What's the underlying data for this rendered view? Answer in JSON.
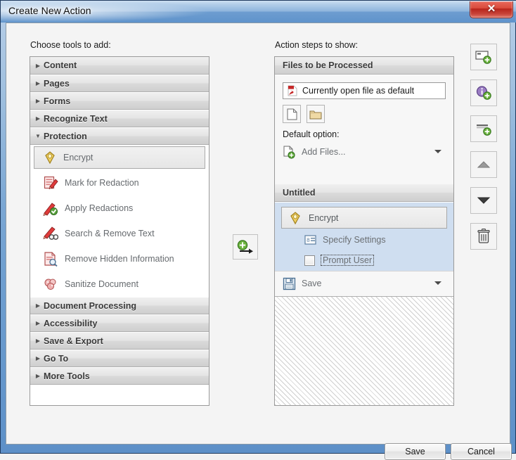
{
  "window": {
    "title": "Create New Action",
    "close_label": "✕"
  },
  "left": {
    "heading": "Choose tools to add:",
    "categories": [
      {
        "label": "Content",
        "expanded": false
      },
      {
        "label": "Pages",
        "expanded": false
      },
      {
        "label": "Forms",
        "expanded": false
      },
      {
        "label": "Recognize Text",
        "expanded": false
      },
      {
        "label": "Protection",
        "expanded": true
      },
      {
        "label": "Document Processing",
        "expanded": false
      },
      {
        "label": "Accessibility",
        "expanded": false
      },
      {
        "label": "Save & Export",
        "expanded": false
      },
      {
        "label": "Go To",
        "expanded": false
      },
      {
        "label": "More Tools",
        "expanded": false
      }
    ],
    "protection_tools": [
      {
        "label": "Encrypt",
        "icon": "shield-icon",
        "selected": true
      },
      {
        "label": "Mark for Redaction",
        "icon": "redaction-pen-icon",
        "selected": false
      },
      {
        "label": "Apply Redactions",
        "icon": "apply-redaction-icon",
        "selected": false
      },
      {
        "label": "Search & Remove Text",
        "icon": "search-remove-icon",
        "selected": false
      },
      {
        "label": "Remove Hidden Information",
        "icon": "remove-hidden-icon",
        "selected": false
      },
      {
        "label": "Sanitize Document",
        "icon": "sanitize-icon",
        "selected": false
      }
    ]
  },
  "right": {
    "heading": "Action steps to show:",
    "files_section": {
      "header": "Files to be Processed",
      "file_value": "Currently open file as default",
      "file_icon": "pdf-icon",
      "add_file_button_icon": "page-icon",
      "add_folder_button_icon": "folder-icon",
      "default_option_label": "Default option:",
      "default_option_value": "Add Files...",
      "default_option_icon": "add-file-icon"
    },
    "action_section": {
      "header": "Untitled",
      "step_label": "Encrypt",
      "step_icon": "shield-icon",
      "sub_items": [
        {
          "label": "Specify Settings",
          "icon": "settings-list-icon",
          "type": "link"
        },
        {
          "label": "Prompt User",
          "icon": "checkbox",
          "type": "checkbox",
          "checked": false,
          "focused": true
        }
      ],
      "save_label": "Save",
      "save_icon": "floppy-icon"
    }
  },
  "center": {
    "add_button_icon": "add-arrow-icon"
  },
  "toolbar": {
    "buttons": [
      {
        "name": "add-panel-button",
        "icon": "add-panel-icon"
      },
      {
        "name": "add-instruction-button",
        "icon": "add-info-icon"
      },
      {
        "name": "add-divider-button",
        "icon": "add-divider-icon"
      },
      {
        "name": "move-up-button",
        "icon": "arrow-up-icon"
      },
      {
        "name": "move-down-button",
        "icon": "arrow-down-icon"
      },
      {
        "name": "delete-button",
        "icon": "trash-icon"
      }
    ]
  },
  "footer": {
    "save": "Save",
    "cancel": "Cancel"
  },
  "colors": {
    "titlebar_blue": "#6d9dd0",
    "close_red": "#c8453a",
    "selection_blue": "#cfdef0",
    "accent_green": "#5aa832"
  }
}
